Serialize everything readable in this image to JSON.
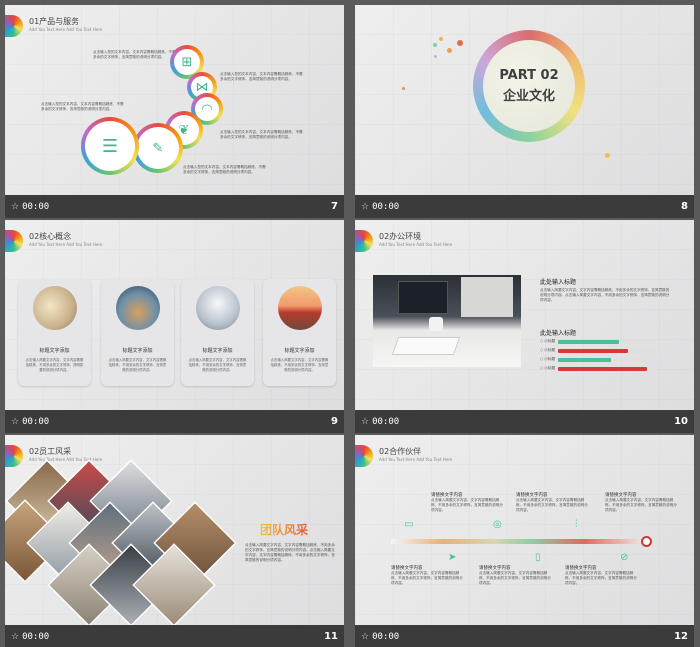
{
  "slides": [
    {
      "title": "01产品与服务",
      "subtitle": "Add You Text Here Add You Text Here",
      "time": "00:00",
      "num": "7",
      "blocks": [
        "点击输入您的文本内容，文本内容需概括精炼，不需多余的文字修饰，言简意赅的说明分项内容。",
        "点击输入您的文本内容，文本内容需概括精炼，不需多余的文字修饰，言简意赅的说明分项内容。",
        "点击输入您的文本内容，文本内容需概括精炼，不需多余的文字修饰，言简意赅的说明分项内容。",
        "点击输入您的文本内容，文本内容需概括精炼，不需多余的文字修饰，言简意赅的说明分项内容。",
        "点击输入您的文本内容，文本内容需概括精炼，不需多余的文字修饰，言简意赅的说明分项内容。"
      ]
    },
    {
      "part": "PART 02",
      "heading": "企业文化",
      "time": "00:00",
      "num": "8"
    },
    {
      "title": "02核心概念",
      "subtitle": "Add You Text Here Add You Text Here",
      "time": "00:00",
      "num": "9",
      "cards": [
        {
          "title": "标题文字添加",
          "text": "点击输入简要文字内容，文字内容需概括精炼，不用多余的文字修饰，简明扼要的说明分项内容。"
        },
        {
          "title": "标题文字添加",
          "text": "点击输入简要文字内容，文字内容需概括精炼，不用多余的文字修饰，言简意赅的说明分项内容。"
        },
        {
          "title": "标题文字添加",
          "text": "点击输入简要文字内容，文字内容需概括精炼，不用多余的文字修饰，言简意赅的说明分项内容。"
        },
        {
          "title": "标题文字添加",
          "text": "点击输入简要文字内容，文字内容需概括精炼，不用多余的文字修饰，言简意赅的说明分项内容。"
        }
      ]
    },
    {
      "title": "02办公环境",
      "subtitle": "Add You Text Here Add You Text Here",
      "time": "00:00",
      "num": "10",
      "heading1": "此处输入标题",
      "para": "点击输入简要文字内容，文字内容需概括精炼，不用多余的文字修饰，言简意赅的说明分项内容。点击输入简要文字内容，不用多余的文字修饰，言简意赅的说明分项内容。",
      "heading2": "此处输入标题",
      "bars": [
        {
          "label": "小标题",
          "value": 0.63,
          "color": "#4bbf9d"
        },
        {
          "label": "小标题",
          "value": 0.72,
          "color": "#d9383a"
        },
        {
          "label": "小标题",
          "value": 0.55,
          "color": "#4bbf9d"
        },
        {
          "label": "小标题",
          "value": 0.92,
          "color": "#d9383a"
        }
      ]
    },
    {
      "title": "02员工风采",
      "subtitle": "Add You Text Here Add You Text Here",
      "time": "00:00",
      "num": "11",
      "heading": "团队风采",
      "para": "点击输入简要文字内容，文字内容需概括精炼，不用多余的文字修饰，言简意赅的说明分项内容。点击输入简要文字内容，文字内容需概括精炼，不用多余的文字修饰，言简意赅的说明分项内容。"
    },
    {
      "title": "02合作伙伴",
      "subtitle": "Add You Text Here Add You Text Here",
      "time": "00:00",
      "num": "12",
      "top": [
        {
          "title": "请替换文字内容",
          "text": "点击输入简要文字内容，文字内容需概括精炼，不用多余的文字修饰，言简意赅的说明分项内容。"
        },
        {
          "title": "请替换文字内容",
          "text": "点击输入简要文字内容，文字内容需概括精炼，不用多余的文字修饰，言简意赅的说明分项内容。"
        },
        {
          "title": "请替换文字内容",
          "text": "点击输入简要文字内容，文字内容需概括精炼，不用多余的文字修饰，言简意赅的说明分项内容。"
        }
      ],
      "bottom": [
        {
          "title": "请替换文字内容",
          "text": "点击输入简要文字内容，文字内容需概括精炼，不用多余的文字修饰，言简意赅的说明分项内容。"
        },
        {
          "title": "请替换文字内容",
          "text": "点击输入简要文字内容，文字内容需概括精炼，不用多余的文字修饰，言简意赅的说明分项内容。"
        },
        {
          "title": "请替换文字内容",
          "text": "点击输入简要文字内容，文字内容需概括精炼，不用多余的文字修饰，言简意赅的说明分项内容。"
        }
      ]
    }
  ],
  "footer_icon": "star-icon"
}
